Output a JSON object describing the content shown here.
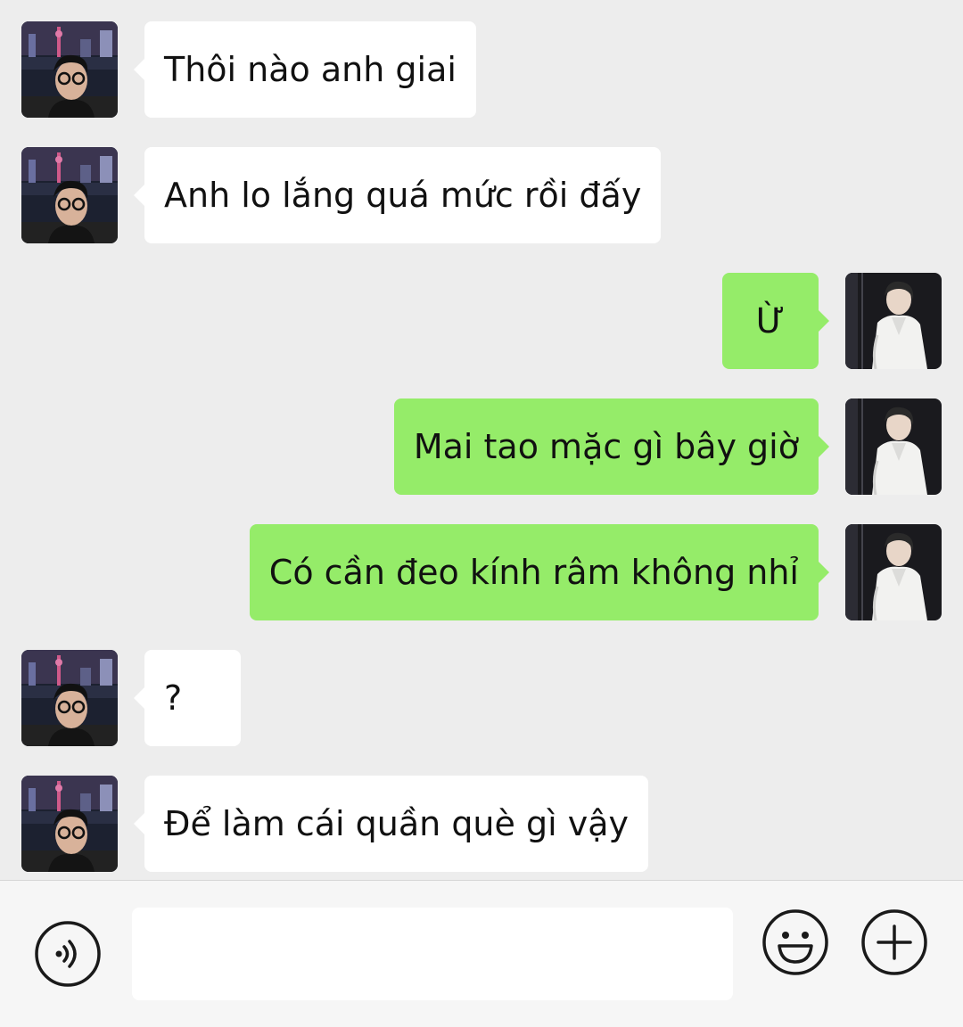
{
  "colors": {
    "background": "#ededed",
    "bubble_incoming": "#ffffff",
    "bubble_outgoing": "#95ec69",
    "composer_background": "#f6f6f6",
    "icon_stroke": "#1a1a1a"
  },
  "messages": [
    {
      "sender": "contact",
      "text": "Thôi nào anh giai"
    },
    {
      "sender": "contact",
      "text": "Anh lo lắng quá mức rồi đấy"
    },
    {
      "sender": "me",
      "text": "Ừ"
    },
    {
      "sender": "me",
      "text": "Mai tao mặc gì bây giờ"
    },
    {
      "sender": "me",
      "text": "Có cần đeo kính râm không nhỉ"
    },
    {
      "sender": "contact",
      "text": "?"
    },
    {
      "sender": "contact",
      "text": "Để làm cái quần què gì vậy"
    }
  ],
  "composer": {
    "input_value": "",
    "voice_icon": "voice-icon",
    "emoji_icon": "emoji-icon",
    "plus_icon": "plus-icon"
  }
}
